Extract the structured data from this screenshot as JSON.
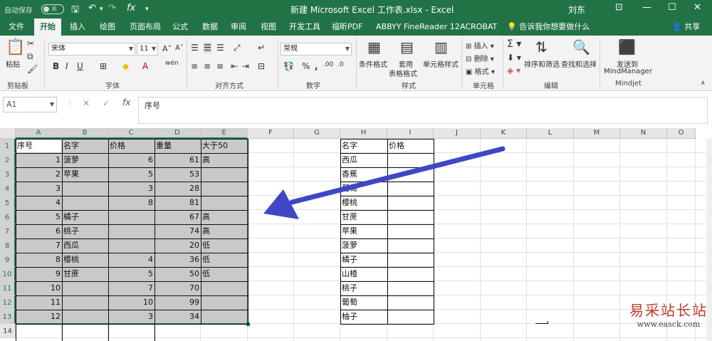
{
  "titlebar": {
    "autosave_label": "自动保存",
    "autosave_state": "关",
    "title": "新建 Microsoft Excel 工作表.xlsx - Excel",
    "user": "刘东"
  },
  "tabs": [
    "文件",
    "开始",
    "插入",
    "绘图",
    "页面布局",
    "公式",
    "数据",
    "审阅",
    "视图",
    "开发工具",
    "福昕PDF",
    "ABBYY FineReader 12",
    "ACROBAT"
  ],
  "active_tab": "开始",
  "tell_me": "告诉我你想要做什么",
  "share": "共享",
  "ribbon": {
    "paste": "粘贴",
    "clipboard": "剪贴板",
    "font_name": "宋体",
    "font_size": "11",
    "font_group": "字体",
    "align_group": "对齐方式",
    "number_format": "常规",
    "number_group": "数字",
    "cond_format": "条件格式",
    "table_format_1": "套用",
    "table_format_2": "表格格式",
    "cell_style": "单元格样式",
    "style_group": "样式",
    "insert": "插入",
    "delete": "删除",
    "format": "格式",
    "cells_group": "单元格",
    "sort_filter": "排序和筛选",
    "find_select": "查找和选择",
    "edit_group": "编辑",
    "mind_1": "发送到",
    "mind_2": "MindManager",
    "mind_group": "Mindjet"
  },
  "formula": {
    "namebox": "A1",
    "content": "序号"
  },
  "columns": [
    "A",
    "B",
    "C",
    "D",
    "E",
    "F",
    "G",
    "H",
    "I",
    "J",
    "K",
    "L",
    "M",
    "N",
    "O"
  ],
  "rows": [
    "1",
    "2",
    "3",
    "4",
    "5",
    "6",
    "7",
    "8",
    "9",
    "10",
    "11",
    "12",
    "13",
    "14"
  ],
  "table_left": {
    "headers": [
      "序号",
      "名字",
      "价格",
      "重量",
      "大于50"
    ],
    "rows": [
      [
        "1",
        "菠萝",
        "6",
        "61",
        "高"
      ],
      [
        "2",
        "苹果",
        "5",
        "53",
        ""
      ],
      [
        "3",
        "",
        "3",
        "28",
        ""
      ],
      [
        "4",
        "",
        "8",
        "81",
        ""
      ],
      [
        "5",
        "橘子",
        "",
        "67",
        "高"
      ],
      [
        "6",
        "桃子",
        "",
        "74",
        "高"
      ],
      [
        "7",
        "西瓜",
        "",
        "20",
        "低"
      ],
      [
        "8",
        "樱桃",
        "4",
        "36",
        "低"
      ],
      [
        "9",
        "甘蔗",
        "5",
        "50",
        "低"
      ],
      [
        "10",
        "",
        "7",
        "70",
        ""
      ],
      [
        "11",
        "",
        "10",
        "99",
        ""
      ],
      [
        "12",
        "",
        "3",
        "34",
        ""
      ]
    ]
  },
  "table_right": {
    "headers": [
      "名字",
      "价格"
    ],
    "names": [
      "西瓜",
      "香蕉",
      "葡萄",
      "樱桃",
      "甘蔗",
      "苹果",
      "菠萝",
      "橘子",
      "山楂",
      "桃子",
      "葡萄",
      "柚子"
    ]
  },
  "watermark": {
    "line1": "易采站长站",
    "line2": "www.easck.com"
  },
  "colors": {
    "excel_green": "#217346",
    "arrow": "#3f47c4",
    "selection": "#c9c9c9"
  }
}
